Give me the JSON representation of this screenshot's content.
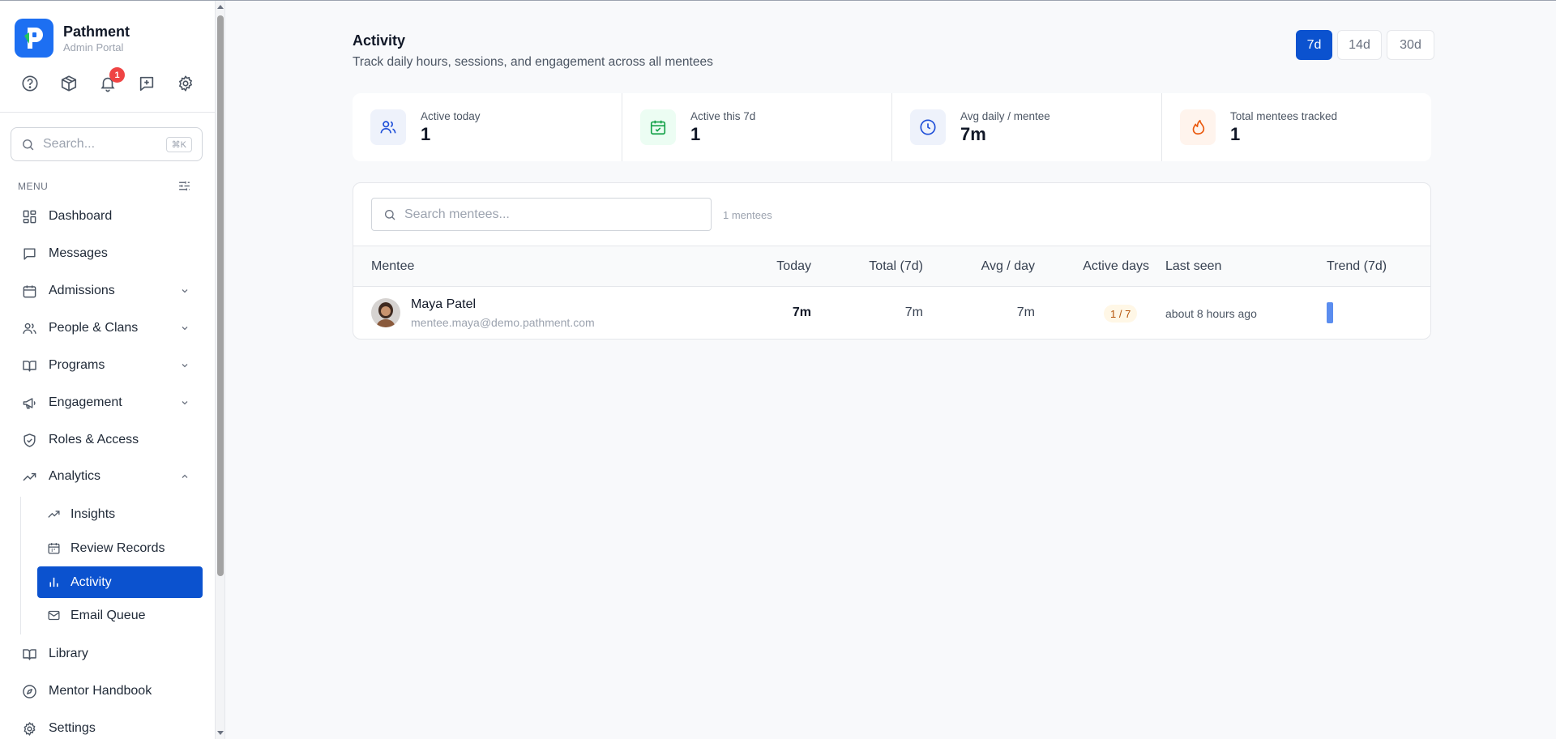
{
  "brand": {
    "name": "Pathment",
    "subtitle": "Admin Portal",
    "logo_letter": "P"
  },
  "toolbar": {
    "notification_count": "1"
  },
  "sidebar": {
    "search_placeholder": "Search...",
    "search_shortcut": "⌘K",
    "menu_label": "MENU",
    "items": [
      {
        "label": "Dashboard"
      },
      {
        "label": "Messages"
      },
      {
        "label": "Admissions"
      },
      {
        "label": "People & Clans"
      },
      {
        "label": "Programs"
      },
      {
        "label": "Engagement"
      },
      {
        "label": "Roles & Access"
      },
      {
        "label": "Analytics"
      },
      {
        "label": "Library"
      },
      {
        "label": "Mentor Handbook"
      },
      {
        "label": "Settings"
      }
    ],
    "analytics_sub": [
      {
        "label": "Insights"
      },
      {
        "label": "Review Records"
      },
      {
        "label": "Activity"
      },
      {
        "label": "Email Queue"
      }
    ]
  },
  "header": {
    "title": "Activity",
    "subtitle": "Track daily hours, sessions, and engagement across all mentees"
  },
  "range": {
    "options": [
      "7d",
      "14d",
      "30d"
    ],
    "selected": "7d"
  },
  "stats": [
    {
      "label": "Active today",
      "value": "1"
    },
    {
      "label": "Active this 7d",
      "value": "1"
    },
    {
      "label": "Avg daily / mentee",
      "value": "7m"
    },
    {
      "label": "Total mentees tracked",
      "value": "1"
    }
  ],
  "table": {
    "search_placeholder": "Search mentees...",
    "count": "1 mentees",
    "columns": [
      "Mentee",
      "Today",
      "Total (7d)",
      "Avg / day",
      "Active days",
      "Last seen",
      "Trend (7d)"
    ],
    "rows": [
      {
        "name": "Maya Patel",
        "email": "mentee.maya@demo.pathment.com",
        "today": "7m",
        "total": "7m",
        "avg": "7m",
        "active_days": "1 / 7",
        "last_seen": "about 8 hours ago"
      }
    ]
  },
  "colors": {
    "accent": "#0b52cf",
    "brand": "#1d6ff2",
    "badge": "#ef4444"
  }
}
